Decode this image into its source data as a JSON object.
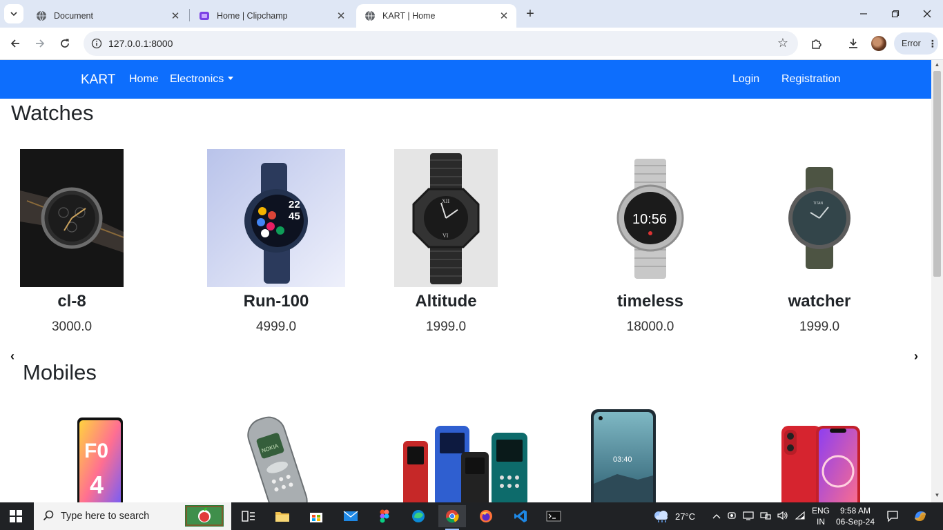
{
  "browser": {
    "tabs": [
      {
        "title": "Document",
        "favicon": "globe-icon"
      },
      {
        "title": "Home | Clipchamp",
        "favicon": "clipchamp-icon"
      },
      {
        "title": "KART | Home",
        "favicon": "globe-icon",
        "active": true
      }
    ],
    "url": "127.0.0.1:8000",
    "profile_status": "Error"
  },
  "navbar": {
    "brand": "KART",
    "links": {
      "home": "Home",
      "electronics": "Electronics",
      "login": "Login",
      "registration": "Registration"
    },
    "color": "#0d6efd"
  },
  "sections": {
    "watches": {
      "title": "Watches",
      "products": [
        {
          "name": "cl-8",
          "price": "3000.0"
        },
        {
          "name": "Run-100",
          "price": "4999.0"
        },
        {
          "name": "Altitude",
          "price": "1999.0"
        },
        {
          "name": "timeless",
          "price": "18000.0"
        },
        {
          "name": "watcher",
          "price": "1999.0"
        }
      ],
      "prev": "‹",
      "next": "›"
    },
    "mobiles": {
      "title": "Mobiles"
    }
  },
  "taskbar": {
    "search_placeholder": "Type here to search",
    "weather": "27°C",
    "lang_top": "ENG",
    "lang_bottom": "IN",
    "time": "9:58 AM",
    "date": "06-Sep-24"
  }
}
